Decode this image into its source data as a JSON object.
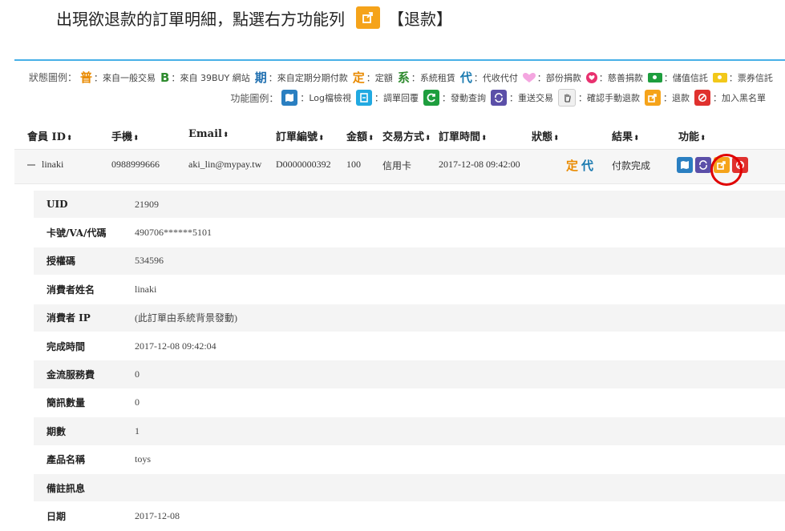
{
  "instruction": {
    "before": "出現欲退款的訂單明細，點選右方功能列",
    "after": "【退款】"
  },
  "legend_status": {
    "title": "狀態圖例：",
    "items": [
      {
        "glyph": "普",
        "label": "：來自一般交易"
      },
      {
        "glyph": "B",
        "label": "：來自 39BUY 網站"
      },
      {
        "glyph": "期",
        "label": "：來自定期分期付款"
      },
      {
        "glyph": "定",
        "label": "：定額"
      },
      {
        "glyph": "系",
        "label": "：系統租賃"
      },
      {
        "glyph": "代",
        "label": "：代收代付"
      },
      {
        "label": "：部份捐款",
        "icon": "pink-heart-icon"
      },
      {
        "label": "：慈善捐款",
        "icon": "charity-heart-icon"
      },
      {
        "label": "：儲值信託",
        "icon": "green-bill-icon"
      },
      {
        "label": "：票券信託",
        "icon": "yellow-bill-icon"
      }
    ]
  },
  "legend_function": {
    "title": "功能圖例：",
    "items": [
      {
        "label": "：Log檔檢視",
        "icon": "log-view-icon",
        "color": "#2a7fc1"
      },
      {
        "label": "：調單回覆",
        "icon": "reply-icon",
        "color": "#21a9e1"
      },
      {
        "label": "：發動查詢",
        "icon": "query-icon",
        "color": "#1e9e3e"
      },
      {
        "label": "：重送交易",
        "icon": "resend-icon",
        "color": "#5b4fa8"
      },
      {
        "label": "：確認手動退款",
        "icon": "hand-icon",
        "color": "#f0f0f0"
      },
      {
        "label": "：退款",
        "icon": "refund-icon",
        "color": "#f5a31a"
      },
      {
        "label": "：加入黑名單",
        "icon": "blacklist-icon",
        "color": "#e0312e"
      }
    ]
  },
  "table": {
    "columns": [
      "會員 ID",
      "手機",
      "Email",
      "訂單編號",
      "金額",
      "交易方式",
      "訂單時間",
      "狀態",
      "結果",
      "功能"
    ],
    "order": {
      "member_id": "linaki",
      "phone": "0988999666",
      "email": "aki_lin@mypay.tw",
      "order_no": "D0000000392",
      "amount": "100",
      "method": "信用卡",
      "time": "2017-12-08 09:42:00",
      "status_badges": [
        "定",
        "代"
      ],
      "result": "付款完成"
    }
  },
  "details": [
    {
      "label": "UID",
      "value": "21909"
    },
    {
      "label": "卡號/VA/代碼",
      "value": "490706******5101"
    },
    {
      "label": "授權碼",
      "value": "534596"
    },
    {
      "label": "消費者姓名",
      "value": "linaki"
    },
    {
      "label": "消費者 IP",
      "value": "(此訂單由系統背景發動)"
    },
    {
      "label": "完成時間",
      "value": "2017-12-08 09:42:04"
    },
    {
      "label": "金流服務費",
      "value": "0"
    },
    {
      "label": "簡訊數量",
      "value": "0"
    },
    {
      "label": "期數",
      "value": "1"
    },
    {
      "label": "產品名稱",
      "value": "toys"
    },
    {
      "label": "備註訊息",
      "value": ""
    },
    {
      "label": "日期",
      "value": "2017-12-08"
    }
  ],
  "colors": {
    "accent": "#47b0e7",
    "refund": "#f5a31a",
    "highlight": "#e00000"
  }
}
